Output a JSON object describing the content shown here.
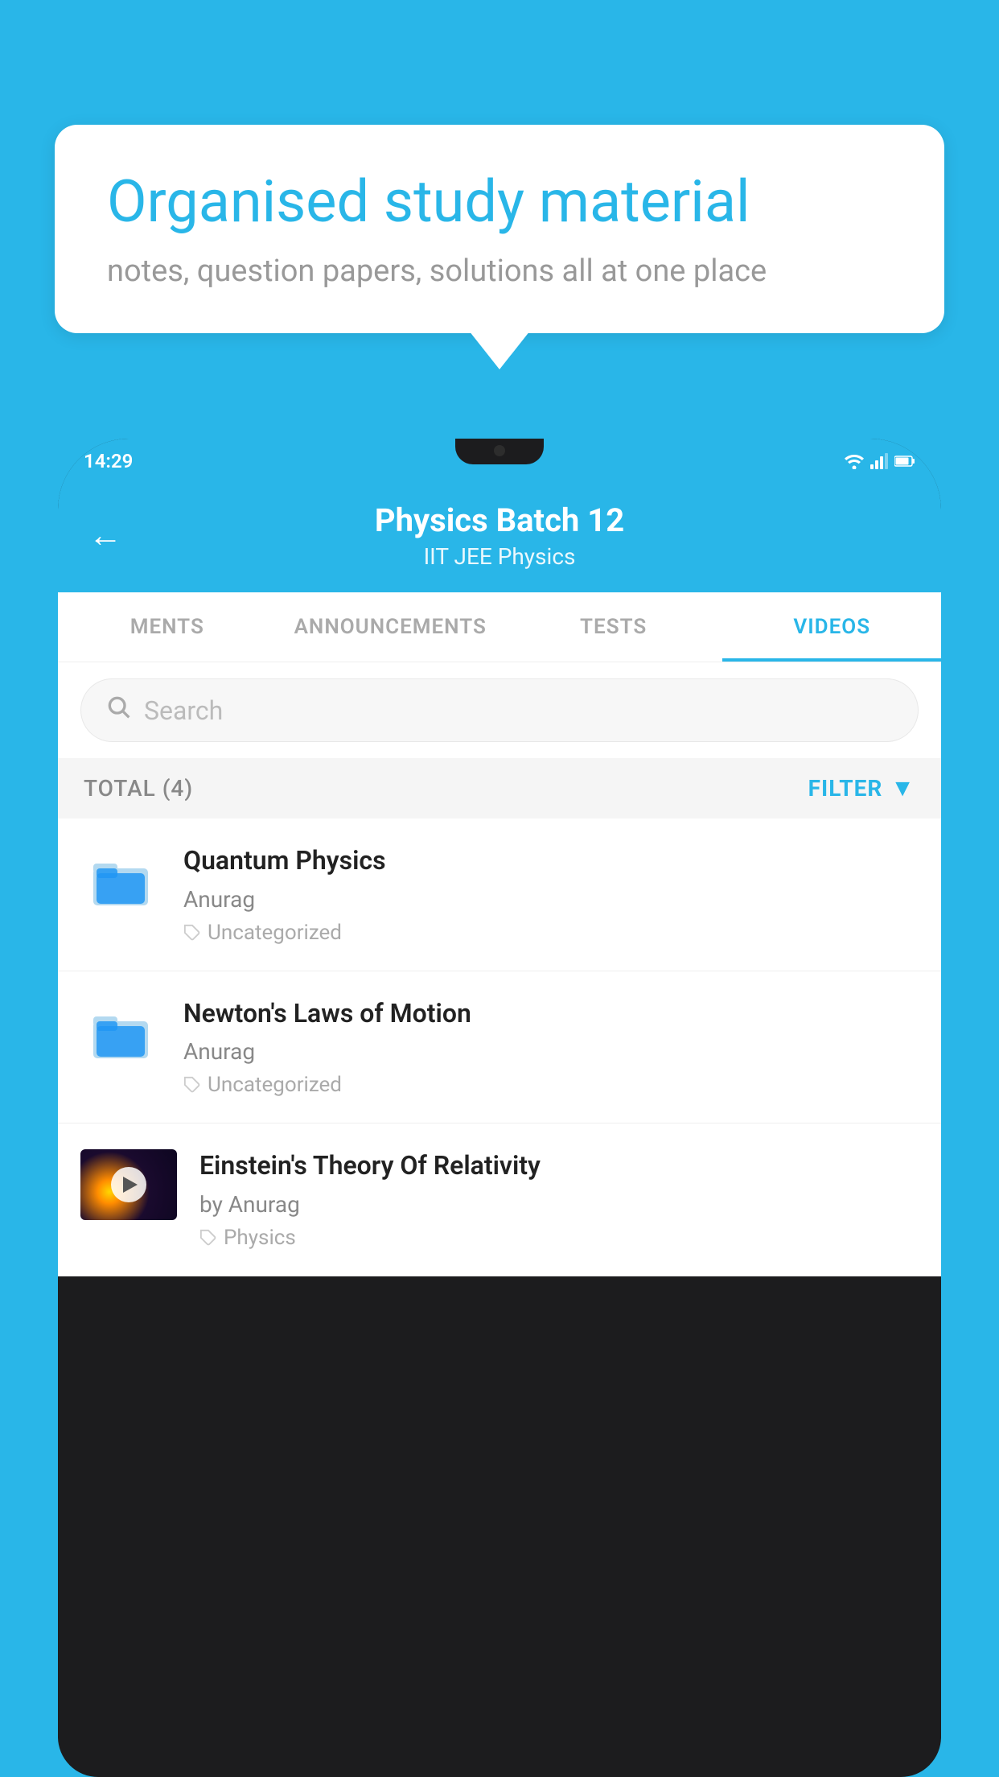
{
  "background": {
    "color": "#29b6e8"
  },
  "speech_bubble": {
    "title": "Organised study material",
    "subtitle": "notes, question papers, solutions all at one place"
  },
  "phone": {
    "status_bar": {
      "time": "14:29"
    },
    "header": {
      "title": "Physics Batch 12",
      "subtitle": "IIT JEE   Physics",
      "back_label": "←"
    },
    "tabs": [
      {
        "label": "MENTS",
        "active": false
      },
      {
        "label": "ANNOUNCEMENTS",
        "active": false
      },
      {
        "label": "TESTS",
        "active": false
      },
      {
        "label": "VIDEOS",
        "active": true
      }
    ],
    "search": {
      "placeholder": "Search"
    },
    "filter": {
      "total_label": "TOTAL (4)",
      "button_label": "FILTER"
    },
    "videos": [
      {
        "title": "Quantum Physics",
        "author": "Anurag",
        "tag": "Uncategorized",
        "has_thumb": false
      },
      {
        "title": "Newton's Laws of Motion",
        "author": "Anurag",
        "tag": "Uncategorized",
        "has_thumb": false
      },
      {
        "title": "Einstein's Theory Of Relativity",
        "author": "by Anurag",
        "tag": "Physics",
        "has_thumb": true
      }
    ]
  }
}
